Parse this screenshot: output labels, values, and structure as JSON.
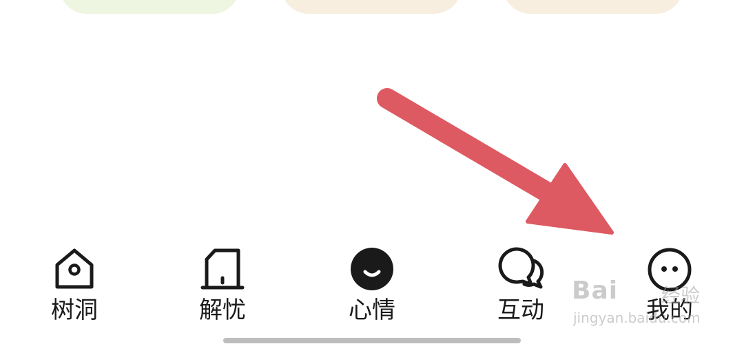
{
  "top_cards": [
    {
      "color": "#EEF5E0"
    },
    {
      "color": "#F7EEDF"
    },
    {
      "color": "#F7EEDF"
    }
  ],
  "annotation_arrow": {
    "color": "#DE5A62",
    "points_to": "我的"
  },
  "bottom_nav": {
    "items": [
      {
        "label": "树洞",
        "icon": "tree-hole-icon"
      },
      {
        "label": "解忧",
        "icon": "relief-icon"
      },
      {
        "label": "心情",
        "icon": "mood-smile-icon",
        "active": true
      },
      {
        "label": "互动",
        "icon": "chat-bubbles-icon"
      },
      {
        "label": "我的",
        "icon": "profile-face-icon"
      }
    ]
  },
  "watermark": {
    "brand": "Bai",
    "name": "经验",
    "url": "jingyan.baidu.com"
  }
}
